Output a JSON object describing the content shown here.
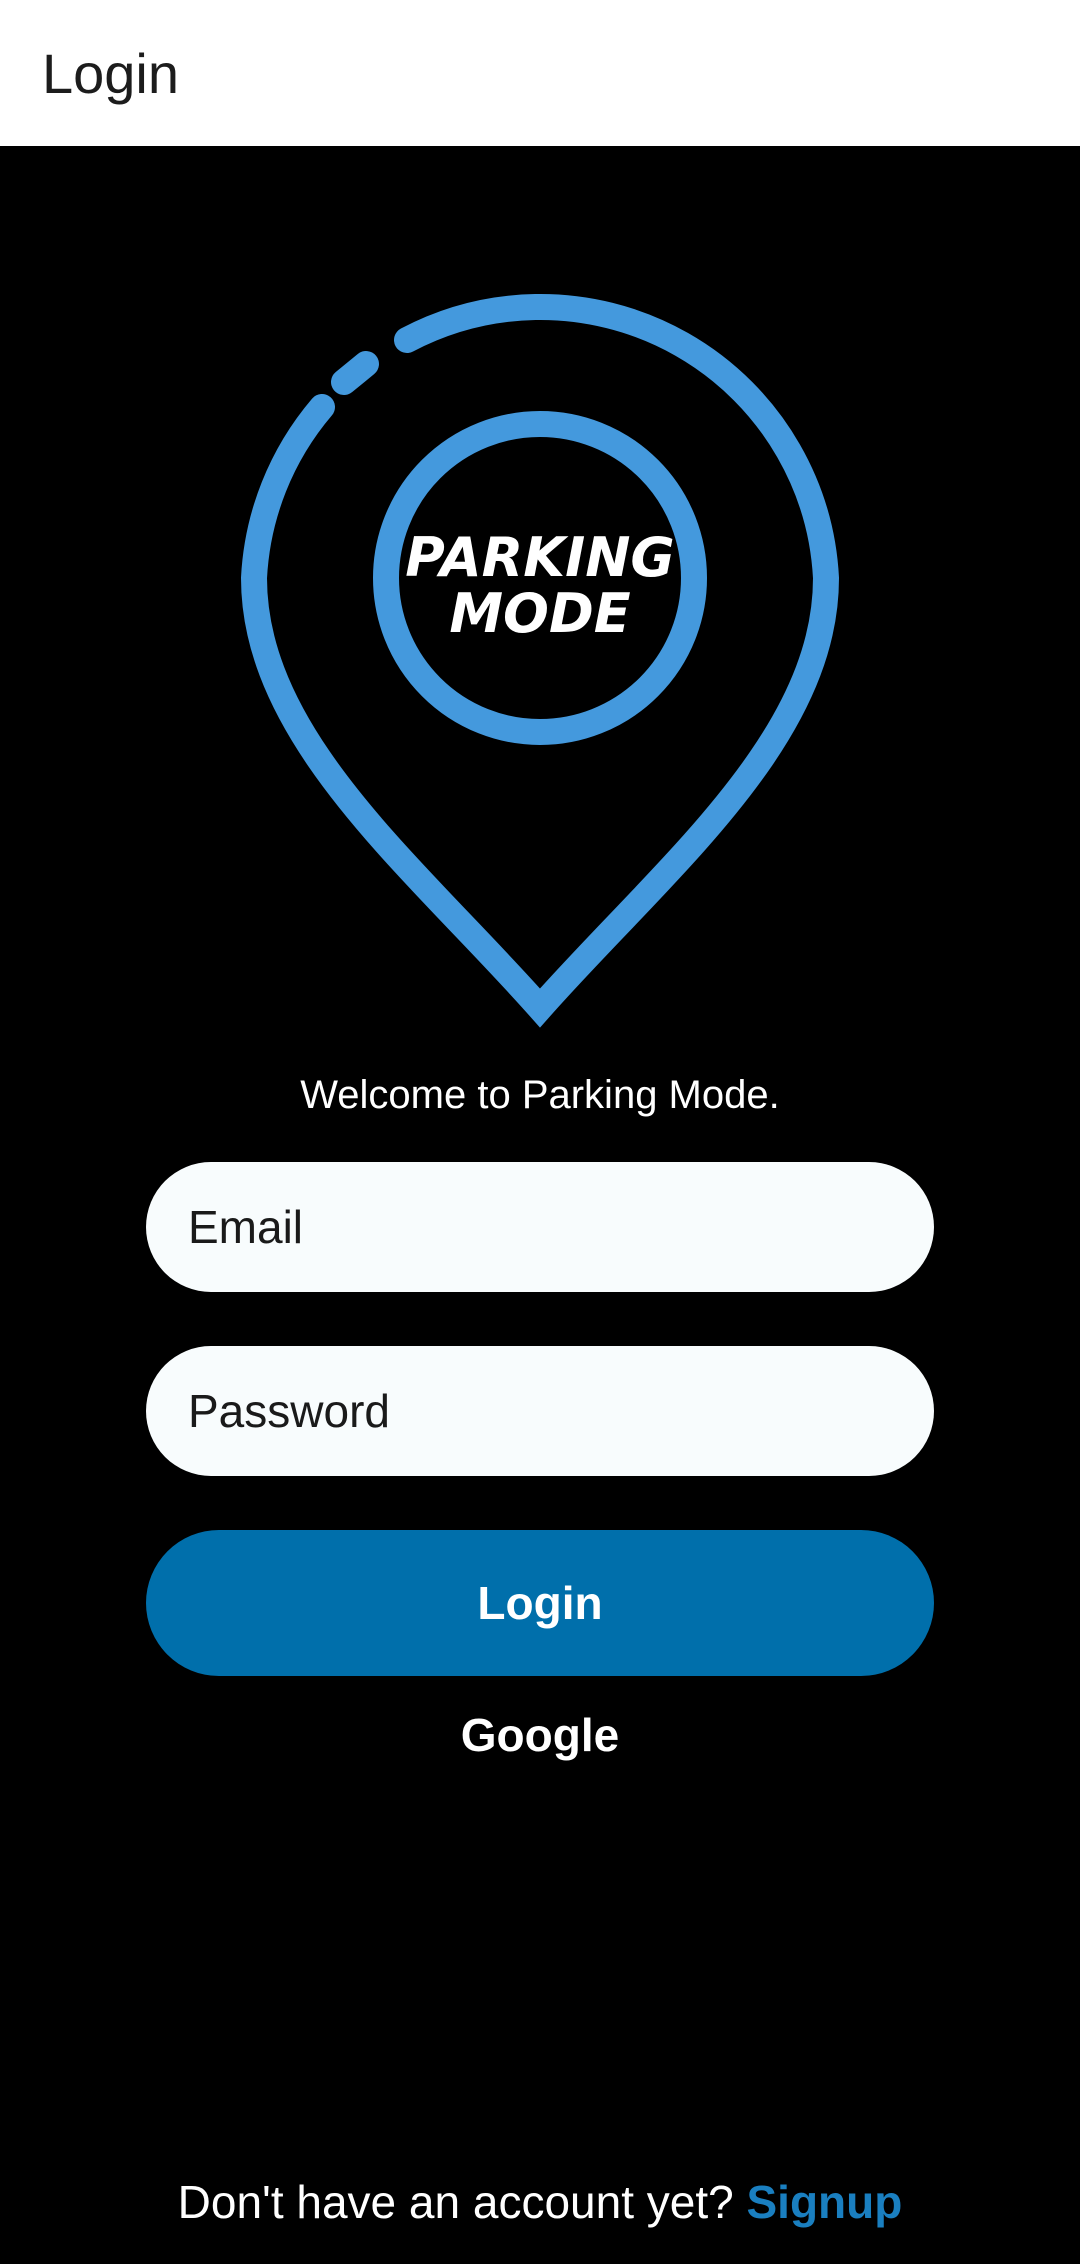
{
  "app_bar": {
    "title": "Login"
  },
  "logo": {
    "line1": "PARKING",
    "line2": "MODE",
    "accent_color": "#4499dd",
    "icon": "location-pin-icon"
  },
  "welcome_text": "Welcome to Parking Mode.",
  "form": {
    "email_placeholder": "Email",
    "password_placeholder": "Password",
    "login_label": "Login",
    "google_label": "Google"
  },
  "signup": {
    "prompt": "Don't have an account yet?",
    "link_label": "Signup"
  },
  "colors": {
    "background": "#000000",
    "primary_button": "#006fab",
    "link": "#1a7fc0",
    "input_background": "#f8fcfd"
  }
}
